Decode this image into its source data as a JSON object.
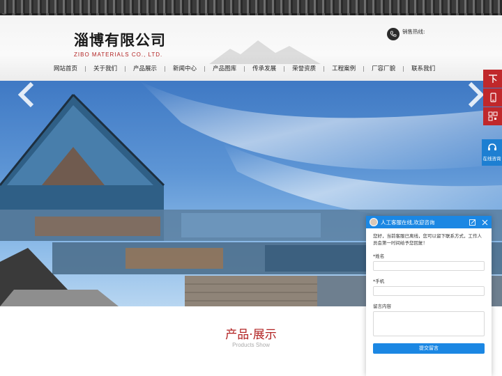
{
  "logo": {
    "name_cn": "淄博有限公司",
    "name_en": "ZIBO  MATERIALS CO., LTD."
  },
  "hotline": {
    "label": "销售热线:"
  },
  "nav": [
    {
      "label": "网站首页"
    },
    {
      "label": "关于我们"
    },
    {
      "label": "产品展示"
    },
    {
      "label": "新闻中心"
    },
    {
      "label": "产品图库"
    },
    {
      "label": "传承发展"
    },
    {
      "label": "荣誉资质"
    },
    {
      "label": "工程案例"
    },
    {
      "label": "厂容厂貌"
    },
    {
      "label": "联系我们"
    }
  ],
  "section": {
    "title": "产品·展示",
    "subtitle": "Products Show"
  },
  "sidebar": {
    "consult_label": "在线咨询"
  },
  "chat": {
    "header": "人工客服在线,欢迎咨询",
    "notice": "您好，当前客服已离线，您可以留下联系方式，工作人员会第一时间给予您回复！",
    "name_label": "*姓名",
    "phone_label": "*手机",
    "message_label": "留言内容",
    "submit_label": "提交留言"
  },
  "colors": {
    "brand_red": "#c0282b",
    "chat_blue": "#1b87e3",
    "title_red": "#b22222"
  },
  "icons": [
    "phone-icon",
    "arrow-left-icon",
    "arrow-right-icon",
    "top-icon",
    "mobile-icon",
    "qrcode-icon",
    "headset-icon",
    "minimize-icon",
    "close-icon"
  ]
}
